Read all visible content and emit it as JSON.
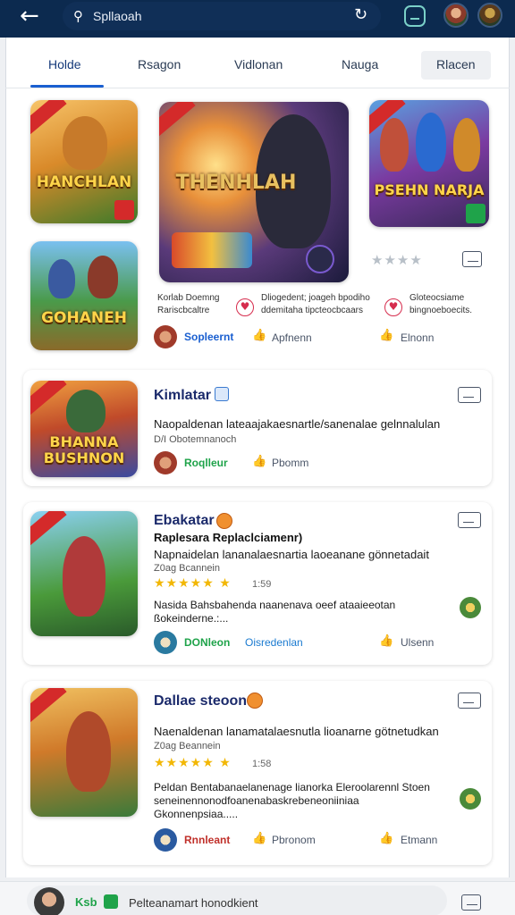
{
  "topbar": {
    "back_icon": "arrow-left-icon",
    "search_value": "Spllaoah",
    "search_icon": "search-icon",
    "refresh_icon": "refresh-icon"
  },
  "tabs": [
    {
      "label": "Holde",
      "active": true
    },
    {
      "label": "Rsagon",
      "active": false
    },
    {
      "label": "Vidlonan",
      "active": false
    },
    {
      "label": "Nauga",
      "active": false
    },
    {
      "label": "Rlacen",
      "active": false
    }
  ],
  "featured": {
    "tiles": [
      {
        "title": "HANCHLAN"
      },
      {
        "title": "THENHLAH"
      },
      {
        "title": "PSEHN NARJA"
      },
      {
        "title": "GOHANEH"
      }
    ],
    "rating_stars": "★★★★",
    "col1": {
      "text": "Korlab Doemng Rariscbcaltre"
    },
    "col2": {
      "text": "Dliogedent; joageh bpodiho ddemitaha tipcteocbcaars"
    },
    "col3": {
      "text": "Gloteocsiame bingnoeboecits."
    },
    "author": "Sopleernt",
    "action1": "Apfnenn",
    "action2": "Elnonn"
  },
  "cards": [
    {
      "tile_title": "BHANNA BUSHNON",
      "title": "Kimlatar",
      "desc1": "Naopaldenan lateaajakaesnartle/sanenalae gelnnalulan",
      "meta": "D/I Obotemnanoch",
      "author": "Roqlleur",
      "action": "Pbomm"
    },
    {
      "title": "Ebakatar",
      "subtitle": "Raplesara Replaclciamenr)",
      "desc1": "Napnaidelan lananalaesnartia laoeanane gönnetadait",
      "meta": "Z0ag Bcannein",
      "stars": "★★★★★ ★",
      "rating": "1:59",
      "desc2": "Nasida Bahsbahenda naanenava oeef ataaieeotan ßokeinderne.:...",
      "author": "DONleon",
      "author2": "Oisredenlan",
      "action": "Ulsenn"
    },
    {
      "title": "Dallae steoon",
      "desc1": "Naenaldenan lanamatalaesnutla lioanarne götnetudkan",
      "meta": "Z0ag Beannein",
      "stars": "★★★★★ ★",
      "rating": "1:58",
      "desc2": "Peldan Bentabanaelanenage lianorka Eleroolarennl Stoen seneinennonodfoanenabaskrebeneoniiniaa Gkonnenpsiaa.....",
      "author": "Rnnleant",
      "action1": "Pbronom",
      "action2": "Etmann"
    }
  ],
  "bottom": {
    "label_green": "Ksb",
    "text": "Pelteanamart honodkient"
  }
}
